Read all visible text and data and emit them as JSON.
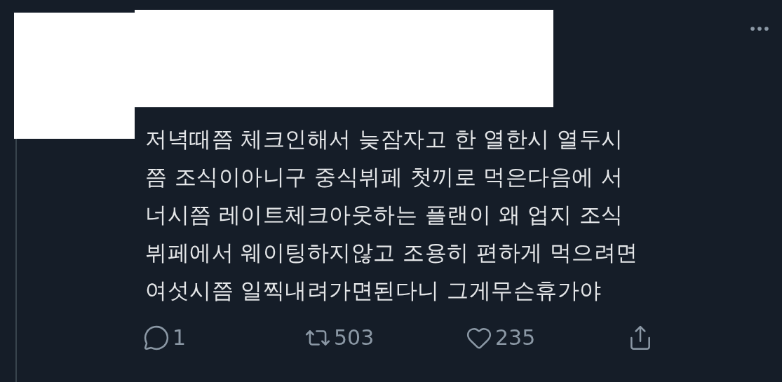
{
  "tweet": {
    "text": "저녁때쯤 체크인해서 늦잠자고 한 열한시 열두시\n쯤 조식이아니구 중식뷔페 첫끼로 먹은다음에 서\n너시쯤 레이트체크아웃하는 플랜이 왜 업지 조식\n뷔페에서 웨이팅하지않고 조용히 편하게 먹으려면\n여섯시쯤 일찍내려가면된다니 그게무슨휴가야",
    "actions": [
      {
        "kind": "reply",
        "count": "1"
      },
      {
        "kind": "retweet",
        "count": "503"
      },
      {
        "kind": "like",
        "count": "235"
      },
      {
        "kind": "share"
      }
    ]
  }
}
